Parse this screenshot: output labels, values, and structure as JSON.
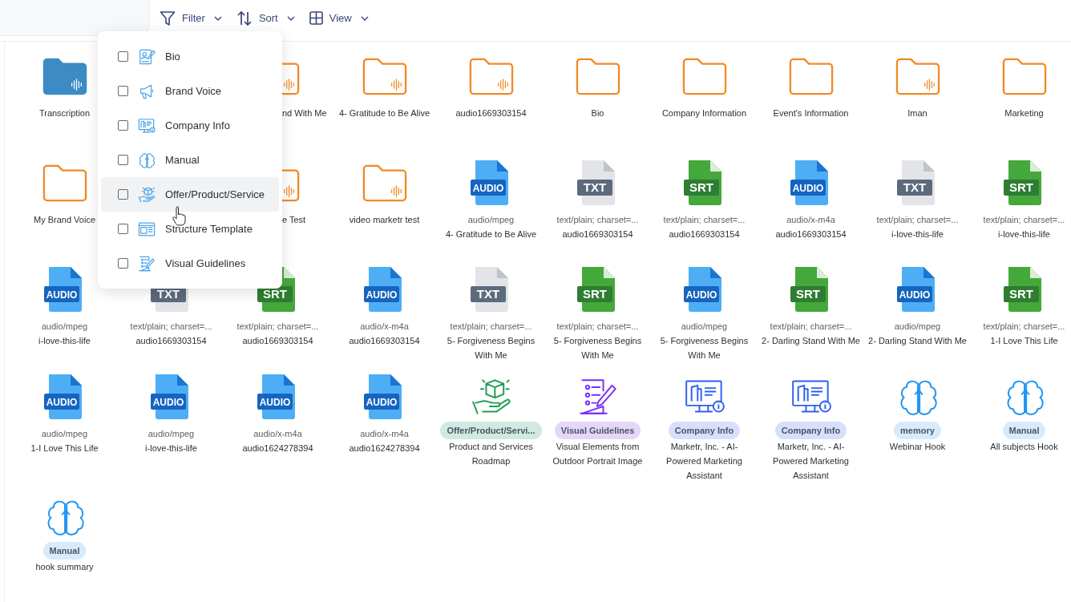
{
  "toolbar": [
    {
      "kind": "filter",
      "label": "Filter"
    },
    {
      "kind": "sort",
      "label": "Sort"
    },
    {
      "kind": "view",
      "label": "View"
    }
  ],
  "filter_menu": [
    {
      "label": "Bio",
      "checked": false,
      "highlighted": false
    },
    {
      "label": "Brand Voice",
      "checked": false,
      "highlighted": false
    },
    {
      "label": "Company Info",
      "checked": false,
      "highlighted": false
    },
    {
      "label": "Manual",
      "checked": false,
      "highlighted": false
    },
    {
      "label": "Offer/Product/Service",
      "checked": false,
      "highlighted": true
    },
    {
      "label": "Structure Template",
      "checked": false,
      "highlighted": false
    },
    {
      "label": "Visual Guidelines",
      "checked": false,
      "highlighted": false
    }
  ],
  "rows": [
    [
      {
        "kind": "transcripts",
        "waveform": true,
        "name": "Transcription"
      },
      {
        "kind": "covered"
      },
      {
        "kind": "folder",
        "waveform": true,
        "name": "nd With Me",
        "cut_left": true
      },
      {
        "kind": "folder",
        "waveform": true,
        "name": "4- Gratitude to Be Alive"
      },
      {
        "kind": "folder",
        "waveform": true,
        "name": "audio1669303154"
      },
      {
        "kind": "folder",
        "waveform": false,
        "name": "Bio"
      },
      {
        "kind": "folder",
        "waveform": false,
        "name": "Company Information"
      },
      {
        "kind": "folder",
        "waveform": false,
        "name": "Event's Information"
      },
      {
        "kind": "folder",
        "waveform": true,
        "name": "Iman"
      },
      {
        "kind": "folder",
        "waveform": false,
        "name": "Marketing"
      }
    ],
    [
      {
        "kind": "folder",
        "waveform": false,
        "name": "My Brand Voice"
      },
      {
        "kind": "covered"
      },
      {
        "kind": "folder",
        "waveform": true,
        "name": "e Test",
        "cut_left": true
      },
      {
        "kind": "folder",
        "waveform": true,
        "name": "video marketr test"
      },
      {
        "kind": "audio",
        "badge": "AUDIO",
        "mime": "audio/mpeg",
        "name": "4- Gratitude to Be Alive"
      },
      {
        "kind": "text",
        "badge": "TXT",
        "mime": "text/plain; charset=...",
        "name": "audio1669303154"
      },
      {
        "kind": "subtitle",
        "badge": "SRT",
        "mime": "text/plain; charset=...",
        "name": "audio1669303154"
      },
      {
        "kind": "audio",
        "badge": "AUDIO",
        "mime": "audio/x-m4a",
        "name": "audio1669303154"
      },
      {
        "kind": "text",
        "badge": "TXT",
        "mime": "text/plain; charset=...",
        "name": "i-love-this-life"
      },
      {
        "kind": "subtitle",
        "badge": "SRT",
        "mime": "text/plain; charset=...",
        "name": "i-love-this-life"
      }
    ],
    [
      {
        "kind": "audio",
        "badge": "AUDIO",
        "mime": "audio/mpeg",
        "name": "i-love-this-life"
      },
      {
        "kind": "text",
        "badge": "TXT",
        "mime": "text/plain; charset=...",
        "name": "audio1669303154"
      },
      {
        "kind": "subtitle",
        "badge": "SRT",
        "mime": "text/plain; charset=...",
        "name": "audio1669303154"
      },
      {
        "kind": "audio",
        "badge": "AUDIO",
        "mime": "audio/x-m4a",
        "name": "audio1669303154"
      },
      {
        "kind": "text",
        "badge": "TXT",
        "mime": "text/plain; charset=...",
        "name": "5- Forgiveness Begins With Me"
      },
      {
        "kind": "subtitle",
        "badge": "SRT",
        "mime": "text/plain; charset=...",
        "name": "5- Forgiveness Begins With Me"
      },
      {
        "kind": "audio",
        "badge": "AUDIO",
        "mime": "audio/mpeg",
        "name": "5- Forgiveness Begins With Me"
      },
      {
        "kind": "subtitle",
        "badge": "SRT",
        "mime": "text/plain; charset=...",
        "name": "2- Darling Stand With Me"
      },
      {
        "kind": "audio",
        "badge": "AUDIO",
        "mime": "audio/mpeg",
        "name": "2- Darling Stand With Me"
      },
      {
        "kind": "subtitle",
        "badge": "SRT",
        "mime": "text/plain; charset=...",
        "name": "1-I Love This Life"
      }
    ],
    [
      {
        "kind": "audio",
        "badge": "AUDIO",
        "mime": "audio/mpeg",
        "name": "1-I Love This Life"
      },
      {
        "kind": "audio",
        "badge": "AUDIO",
        "mime": "audio/mpeg",
        "name": "i-love-this-life"
      },
      {
        "kind": "audio",
        "badge": "AUDIO",
        "mime": "audio/x-m4a",
        "name": "audio1624278394"
      },
      {
        "kind": "audio",
        "badge": "AUDIO",
        "mime": "audio/x-m4a",
        "name": "audio1624278394"
      },
      {
        "kind": "offer",
        "tag": "Offer/Product/Servi...",
        "color": "#cfeadf",
        "name": "Product and Services Roadmap"
      },
      {
        "kind": "guideline",
        "tag": "Visual Guidelines",
        "color": "#e4d7f7",
        "name": "Visual Elements from Outdoor Portrait Image"
      },
      {
        "kind": "company",
        "tag": "Company Info",
        "color": "#d6e0fa",
        "name": "Marketr, Inc. - AI-Powered Marketing Assistant"
      },
      {
        "kind": "company",
        "tag": "Company Info",
        "color": "#d6e0fa",
        "name": "Marketr, Inc. - AI-Powered Marketing Assistant"
      },
      {
        "kind": "knowledge",
        "tag": "memory",
        "color": "#d8ebfb",
        "name": "Webinar Hook"
      },
      {
        "kind": "knowledge",
        "tag": "Manual",
        "color": "#d8ebfb",
        "name": "All subjects Hook"
      }
    ],
    [
      {
        "kind": "knowledge",
        "tag": "Manual",
        "color": "#d8ebfb",
        "name": "hook summary"
      }
    ]
  ]
}
